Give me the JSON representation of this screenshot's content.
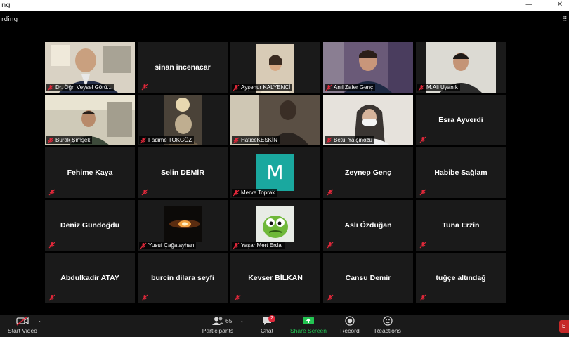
{
  "window": {
    "title": "ng",
    "minimize": "—",
    "restore": "❐",
    "close": "✕"
  },
  "recording_label": "rding",
  "view_icon": "⠿",
  "tiles": [
    {
      "name": "Dr. Öğr. Veysel Görü...",
      "has_video": true,
      "active": true
    },
    {
      "name": "sinan incenacar",
      "has_video": false
    },
    {
      "name": "Ayşenur KALYENCİ",
      "has_video": true
    },
    {
      "name": "Anıl Zafer Genç",
      "has_video": true
    },
    {
      "name": "M.Ali Uyanık",
      "has_video": true
    },
    {
      "name": "Burak Şimşek",
      "has_video": true
    },
    {
      "name": "Fadime TOKGÖZ",
      "has_video": true
    },
    {
      "name": "HaticeKESKİN",
      "has_video": true
    },
    {
      "name": "Betül Yalçınözü",
      "has_video": true
    },
    {
      "name": "Esra Ayverdi",
      "has_video": false
    },
    {
      "name": "Fehime Kaya",
      "has_video": false
    },
    {
      "name": "Selin DEMİR",
      "has_video": false
    },
    {
      "name": "Merve Toprak",
      "has_video": false,
      "avatar_letter": "M"
    },
    {
      "name": "Zeynep Genç",
      "has_video": false
    },
    {
      "name": "Habibe Sağlam",
      "has_video": false
    },
    {
      "name": "Deniz Gündoğdu",
      "has_video": false
    },
    {
      "name": "Yusuf Çağatayhan",
      "has_video": true
    },
    {
      "name": "Yaşar Mert Erdal",
      "has_video": true
    },
    {
      "name": "Aslı Özduğan",
      "has_video": false
    },
    {
      "name": "Tuna Erzin",
      "has_video": false
    },
    {
      "name": "Abdulkadir ATAY",
      "has_video": false
    },
    {
      "name": "burcin dilara seyfi",
      "has_video": false
    },
    {
      "name": "Kevser BİLKAN",
      "has_video": false
    },
    {
      "name": "Cansu Demir",
      "has_video": false
    },
    {
      "name": "tuğçe altındağ",
      "has_video": false
    }
  ],
  "toolbar": {
    "start_video": "Start Video",
    "participants": "Participants",
    "participants_count": "65",
    "chat": "Chat",
    "chat_badge": "2",
    "share_screen": "Share Screen",
    "record": "Record",
    "reactions": "Reactions",
    "end_label": "E"
  },
  "colors": {
    "active_border": "#c7d84a",
    "share_green": "#23c552",
    "mute_red": "#e0283a",
    "avatar_teal": "#1aa89f",
    "tile_bg": "#1a1a1a"
  }
}
